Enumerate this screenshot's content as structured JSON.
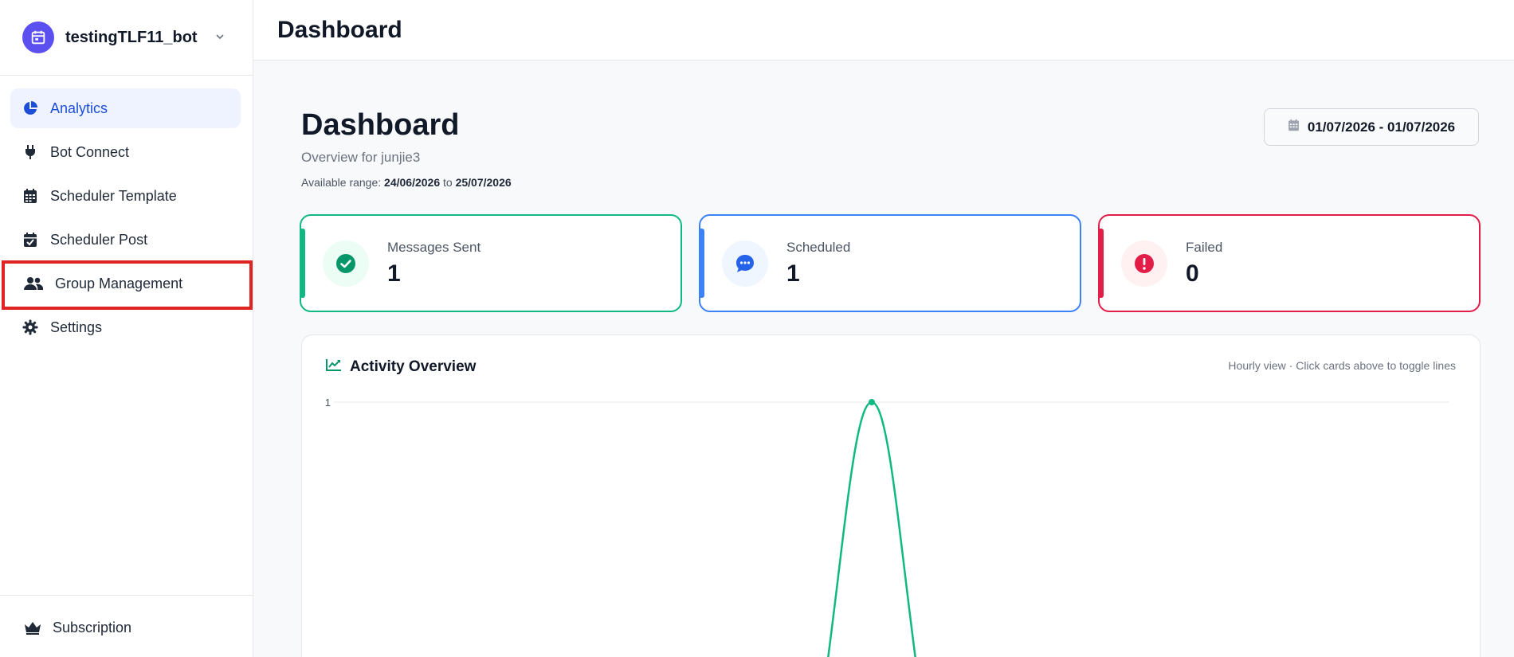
{
  "sidebar": {
    "bot_name": "testingTLF11_bot",
    "items": [
      {
        "label": "Analytics",
        "icon": "pie-chart-icon",
        "active": true
      },
      {
        "label": "Bot Connect",
        "icon": "plug-icon"
      },
      {
        "label": "Scheduler Template",
        "icon": "calendar-icon"
      },
      {
        "label": "Scheduler Post",
        "icon": "calendar-check-icon"
      },
      {
        "label": "Group Management",
        "icon": "users-icon"
      },
      {
        "label": "Settings",
        "icon": "gear-icon"
      }
    ],
    "subscription_label": "Subscription"
  },
  "topbar": {
    "title": "Dashboard"
  },
  "dashboard": {
    "title": "Dashboard",
    "subtitle": "Overview for junjie3",
    "range_prefix": "Available range: ",
    "range_start": "24/06/2026",
    "range_mid": " to ",
    "range_end": "25/07/2026",
    "date_button": "01/07/2026 - 01/07/2026"
  },
  "cards": [
    {
      "label": "Messages Sent",
      "value": "1",
      "color": "#10b981",
      "icon": "check-circle-icon"
    },
    {
      "label": "Scheduled",
      "value": "1",
      "color": "#3b82f6",
      "icon": "chat-bubble-icon"
    },
    {
      "label": "Failed",
      "value": "0",
      "color": "#e11d48",
      "icon": "alert-circle-icon"
    }
  ],
  "activity": {
    "title": "Activity Overview",
    "hint": "Hourly view · Click cards above to toggle lines"
  },
  "chart_data": {
    "type": "line",
    "title": "Activity Overview",
    "y_tick_labels": [
      "1"
    ],
    "ylim": [
      0,
      1
    ],
    "grid": true,
    "series": [
      {
        "color": "#10b981",
        "peak_value": 1
      }
    ]
  },
  "annotation": {
    "highlight_color": "#e02424"
  }
}
